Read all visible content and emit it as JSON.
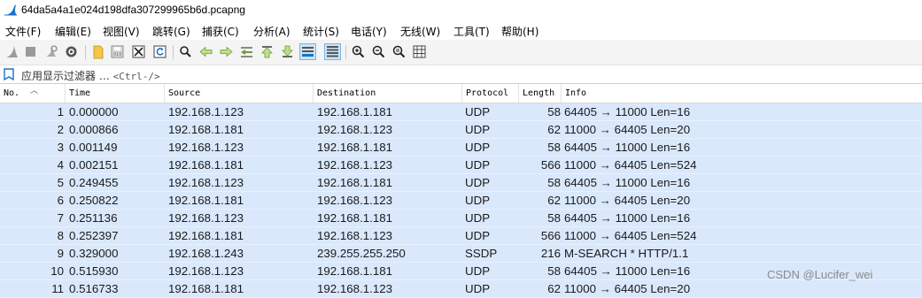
{
  "window": {
    "title": "64da5a4a1e024d198dfa307299965b6d.pcapng"
  },
  "menu": [
    {
      "name": "menu-file",
      "label": "文件(F)"
    },
    {
      "name": "menu-edit",
      "label": "编辑(E)"
    },
    {
      "name": "menu-view",
      "label": "视图(V)"
    },
    {
      "name": "menu-go",
      "label": "跳转(G)"
    },
    {
      "name": "menu-capture",
      "label": "捕获(C)"
    },
    {
      "name": "menu-analyze",
      "label": "分析(A)"
    },
    {
      "name": "menu-statistics",
      "label": "统计(S)"
    },
    {
      "name": "menu-telephony",
      "label": "电话(Y)"
    },
    {
      "name": "menu-wireless",
      "label": "无线(W)"
    },
    {
      "name": "menu-tools",
      "label": "工具(T)"
    },
    {
      "name": "menu-help",
      "label": "帮助(H)"
    }
  ],
  "toolbar": {
    "icons": [
      "shark-fin-start-icon",
      "stop-capture-icon",
      "restart-capture-icon",
      "capture-options-icon",
      "open-file-icon",
      "save-file-icon",
      "close-file-icon",
      "reload-file-icon",
      "find-packet-icon",
      "go-back-icon",
      "go-forward-icon",
      "go-to-packet-icon",
      "go-first-icon",
      "go-last-icon",
      "autoscroll-icon",
      "colorize-icon",
      "zoom-in-icon",
      "zoom-out-icon",
      "zoom-normal-icon",
      "resize-columns-icon"
    ]
  },
  "filter": {
    "placeholder_text": "应用显示过滤器 … ",
    "shortcut": "<Ctrl-/>"
  },
  "columns": [
    "No.",
    "Time",
    "Source",
    "Destination",
    "Protocol",
    "Length",
    "Info"
  ],
  "packets": [
    {
      "no": "1",
      "time": "0.000000",
      "src": "192.168.1.123",
      "dst": "192.168.1.181",
      "proto": "UDP",
      "len": "58",
      "info": "64405 → 11000 Len=16"
    },
    {
      "no": "2",
      "time": "0.000866",
      "src": "192.168.1.181",
      "dst": "192.168.1.123",
      "proto": "UDP",
      "len": "62",
      "info": "11000 → 64405 Len=20"
    },
    {
      "no": "3",
      "time": "0.001149",
      "src": "192.168.1.123",
      "dst": "192.168.1.181",
      "proto": "UDP",
      "len": "58",
      "info": "64405 → 11000 Len=16"
    },
    {
      "no": "4",
      "time": "0.002151",
      "src": "192.168.1.181",
      "dst": "192.168.1.123",
      "proto": "UDP",
      "len": "566",
      "info": "11000 → 64405 Len=524"
    },
    {
      "no": "5",
      "time": "0.249455",
      "src": "192.168.1.123",
      "dst": "192.168.1.181",
      "proto": "UDP",
      "len": "58",
      "info": "64405 → 11000 Len=16"
    },
    {
      "no": "6",
      "time": "0.250822",
      "src": "192.168.1.181",
      "dst": "192.168.1.123",
      "proto": "UDP",
      "len": "62",
      "info": "11000 → 64405 Len=20"
    },
    {
      "no": "7",
      "time": "0.251136",
      "src": "192.168.1.123",
      "dst": "192.168.1.181",
      "proto": "UDP",
      "len": "58",
      "info": "64405 → 11000 Len=16"
    },
    {
      "no": "8",
      "time": "0.252397",
      "src": "192.168.1.181",
      "dst": "192.168.1.123",
      "proto": "UDP",
      "len": "566",
      "info": "11000 → 64405 Len=524"
    },
    {
      "no": "9",
      "time": "0.329000",
      "src": "192.168.1.243",
      "dst": "239.255.255.250",
      "proto": "SSDP",
      "len": "216",
      "info": "M-SEARCH * HTTP/1.1"
    },
    {
      "no": "10",
      "time": "0.515930",
      "src": "192.168.1.123",
      "dst": "192.168.1.181",
      "proto": "UDP",
      "len": "58",
      "info": "64405 → 11000 Len=16"
    },
    {
      "no": "11",
      "time": "0.516733",
      "src": "192.168.1.181",
      "dst": "192.168.1.123",
      "proto": "UDP",
      "len": "62",
      "info": "11000 → 64405 Len=20"
    }
  ],
  "colors": {
    "row_bg": "#dae8fc",
    "accent": "#1a73c8"
  },
  "watermark": "CSDN @Lucifer_wei"
}
